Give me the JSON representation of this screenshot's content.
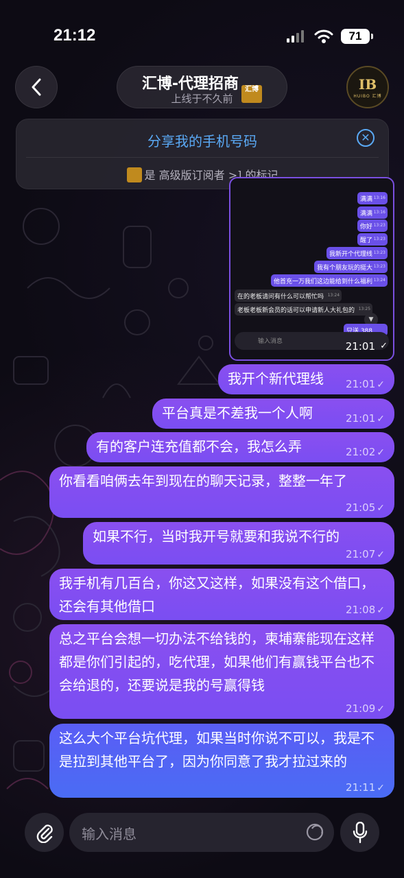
{
  "status_bar": {
    "time": "21:12",
    "battery": "71"
  },
  "header": {
    "title": "汇博-代理招商",
    "badge_text": "汇博",
    "subtitle": "上线于不久前",
    "avatar_letters": "IB",
    "avatar_sub": "HUIBO 汇博"
  },
  "share_banner": {
    "title": "分享我的手机号码",
    "note": "是 高级版订阅者 >] 的标记"
  },
  "thumbnail": {
    "out_messages": [
      {
        "text": "满满",
        "time": "13:16"
      },
      {
        "text": "满满",
        "time": "13:16"
      },
      {
        "text": "你好",
        "time": "13:23"
      },
      {
        "text": "醒了",
        "time": "13:23"
      },
      {
        "text": "我新开个代理线",
        "time": "13:23"
      },
      {
        "text": "我有个朋友玩的挺大",
        "time": "13:23"
      },
      {
        "text": "他首充一万我们这边能给到什么福利",
        "time": "13:24"
      }
    ],
    "in_messages": [
      {
        "text": "在的老板请问有什么可以帮忙吗",
        "time": "13:24"
      },
      {
        "text": "老板老板新会员的话可以申请新人大礼包的",
        "time": "13:25"
      }
    ],
    "last_out": {
      "text": "只送 388",
      "time": ""
    },
    "input_placeholder": "输入消息",
    "time": "21:01"
  },
  "messages": [
    {
      "text": "我开个新代理线",
      "time": "21:01"
    },
    {
      "text": "平台真是不差我一个人啊",
      "time": "21:01"
    },
    {
      "text": "有的客户连充值都不会，我怎么弄",
      "time": "21:02"
    },
    {
      "text": "你看看咱俩去年到现在的聊天记录，整整一年了",
      "time": "21:05"
    },
    {
      "text": "如果不行，当时我开号就要和我说不行的",
      "time": "21:07"
    },
    {
      "text": "我手机有几百台，你这又这样，如果没有这个借口，还会有其他借口",
      "time": "21:08"
    },
    {
      "text": "总之平台会想一切办法不给钱的，柬埔寨能现在这样都是你们引起的，吃代理，如果他们有赢钱平台也不会给退的，还要说是我的号赢得钱",
      "time": "21:09"
    },
    {
      "text": "这么大个平台坑代理，如果当时你说不可以，我是不是拉到其他平台了，因为你同意了我才拉过来的",
      "time": "21:11"
    }
  ],
  "input": {
    "placeholder": "输入消息"
  },
  "colors": {
    "accent": "#7a4ef2",
    "link": "#5aa9f5",
    "background": "#0d0b14"
  },
  "icons": [
    "back-icon",
    "signal-icon",
    "wifi-icon",
    "close-icon",
    "paperclip-icon",
    "sticker-icon",
    "microphone-icon"
  ]
}
